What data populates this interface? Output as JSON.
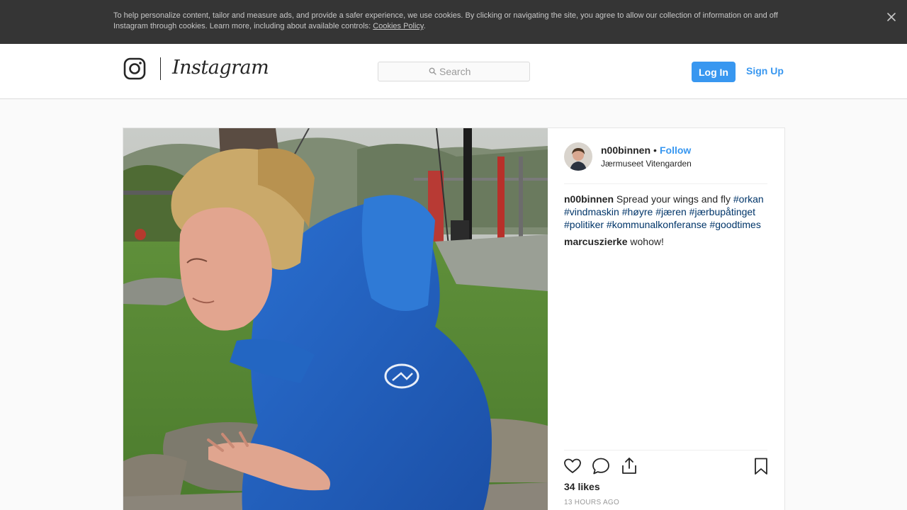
{
  "cookie_banner": {
    "text": "To help personalize content, tailor and measure ads, and provide a safer experience, we use cookies. By clicking or navigating the site, you agree to allow our collection of information on and off Instagram through cookies. Learn more, including about available controls: ",
    "link_label": "Cookies Policy",
    "period": "."
  },
  "header": {
    "wordmark": "Instagram",
    "search_placeholder": "Search",
    "login_label": "Log In",
    "signup_label": "Sign Up"
  },
  "post": {
    "username": "n00binnen",
    "separator": "•",
    "follow_label": "Follow",
    "location": "Jærmuseet Vitengarden",
    "caption": {
      "author": "n00binnen",
      "text": "Spread your wings and fly",
      "hashtags": [
        "#orkan",
        "#vindmaskin",
        "#høyre",
        "#jæren",
        "#jærbupåtinget",
        "#politiker",
        "#kommunalkonferanse",
        "#goodtimes"
      ]
    },
    "comment": {
      "author": "marcuszierke",
      "text": "wohow!"
    },
    "likes": "34 likes",
    "time": "13 HOURS AGO"
  },
  "icons": {
    "close": "close-icon",
    "search": "search-icon",
    "like": "heart-icon",
    "comment": "comment-icon",
    "share": "share-icon",
    "save": "bookmark-icon"
  },
  "colors": {
    "accent": "#3897f0",
    "hashtag": "#003569",
    "banner": "#353535"
  }
}
